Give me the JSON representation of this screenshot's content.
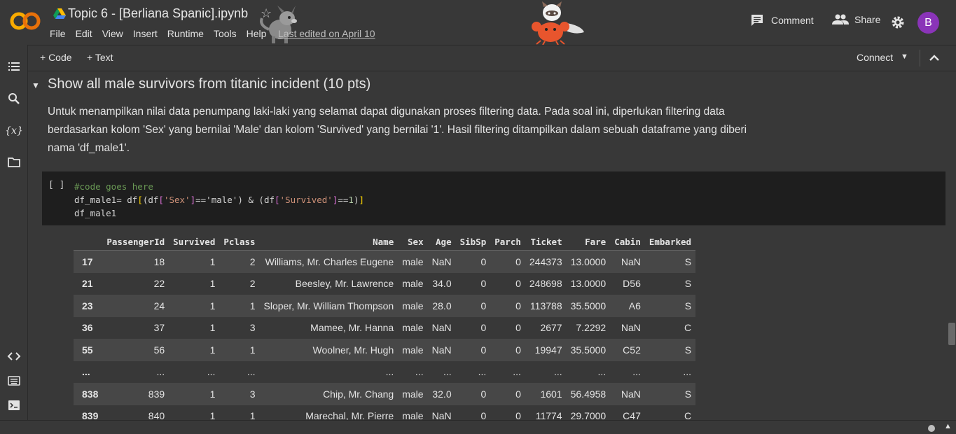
{
  "header": {
    "title": "Topic 6 - [Berliana Spanic].ipynb",
    "menu": [
      "File",
      "Edit",
      "View",
      "Insert",
      "Runtime",
      "Tools",
      "Help"
    ],
    "last_edited": "Last edited on April 10",
    "comment_label": "Comment",
    "share_label": "Share",
    "avatar_letter": "B",
    "logo_text": "CO"
  },
  "toolbar": {
    "add_code": "+ Code",
    "add_text": "+ Text",
    "connect": "Connect"
  },
  "sidebar": {
    "variables_label": "{x}"
  },
  "section": {
    "title": "Show all male survivors from titanic incident (10 pts)",
    "description": "Untuk menampilkan nilai data penumpang laki-laki yang selamat dapat digunakan proses filtering data. Pada soal ini, diperlukan filtering data berdasarkan kolom 'Sex' yang bernilai 'Male' dan kolom 'Survived' yang bernilai '1'. Hasil filtering ditampilkan dalam sebuah dataframe yang diberi nama 'df_male1'."
  },
  "code_cell": {
    "run_indicator": "[ ]",
    "comment": "#code goes here",
    "line2_a": "df_male1= df",
    "line2_b": "(df",
    "str_sex": "'Sex'",
    "eq_male": "=='male') & (df",
    "str_survived": "'Survived'",
    "eq_one": "==",
    "num_one": "1",
    "line3": "df_male1"
  },
  "table": {
    "columns": [
      "",
      "PassengerId",
      "Survived",
      "Pclass",
      "Name",
      "Sex",
      "Age",
      "SibSp",
      "Parch",
      "Ticket",
      "Fare",
      "Cabin",
      "Embarked"
    ],
    "rows": [
      [
        "17",
        "18",
        "1",
        "2",
        "Williams, Mr. Charles Eugene",
        "male",
        "NaN",
        "0",
        "0",
        "244373",
        "13.0000",
        "NaN",
        "S"
      ],
      [
        "21",
        "22",
        "1",
        "2",
        "Beesley, Mr. Lawrence",
        "male",
        "34.0",
        "0",
        "0",
        "248698",
        "13.0000",
        "D56",
        "S"
      ],
      [
        "23",
        "24",
        "1",
        "1",
        "Sloper, Mr. William Thompson",
        "male",
        "28.0",
        "0",
        "0",
        "113788",
        "35.5000",
        "A6",
        "S"
      ],
      [
        "36",
        "37",
        "1",
        "3",
        "Mamee, Mr. Hanna",
        "male",
        "NaN",
        "0",
        "0",
        "2677",
        "7.2292",
        "NaN",
        "C"
      ],
      [
        "55",
        "56",
        "1",
        "1",
        "Woolner, Mr. Hugh",
        "male",
        "NaN",
        "0",
        "0",
        "19947",
        "35.5000",
        "C52",
        "S"
      ],
      [
        "...",
        "...",
        "...",
        "...",
        "...",
        "...",
        "...",
        "...",
        "...",
        "...",
        "...",
        "...",
        "..."
      ],
      [
        "838",
        "839",
        "1",
        "3",
        "Chip, Mr. Chang",
        "male",
        "32.0",
        "0",
        "0",
        "1601",
        "56.4958",
        "NaN",
        "S"
      ],
      [
        "839",
        "840",
        "1",
        "1",
        "Marechal, Mr. Pierre",
        "male",
        "NaN",
        "0",
        "0",
        "11774",
        "29.7000",
        "C47",
        "C"
      ]
    ]
  },
  "colors": {
    "background": "#383838",
    "cell_background": "#1e1e1e",
    "row_stripe": "#474747",
    "avatar": "#8a34b8",
    "logo": "#f9ab00"
  }
}
